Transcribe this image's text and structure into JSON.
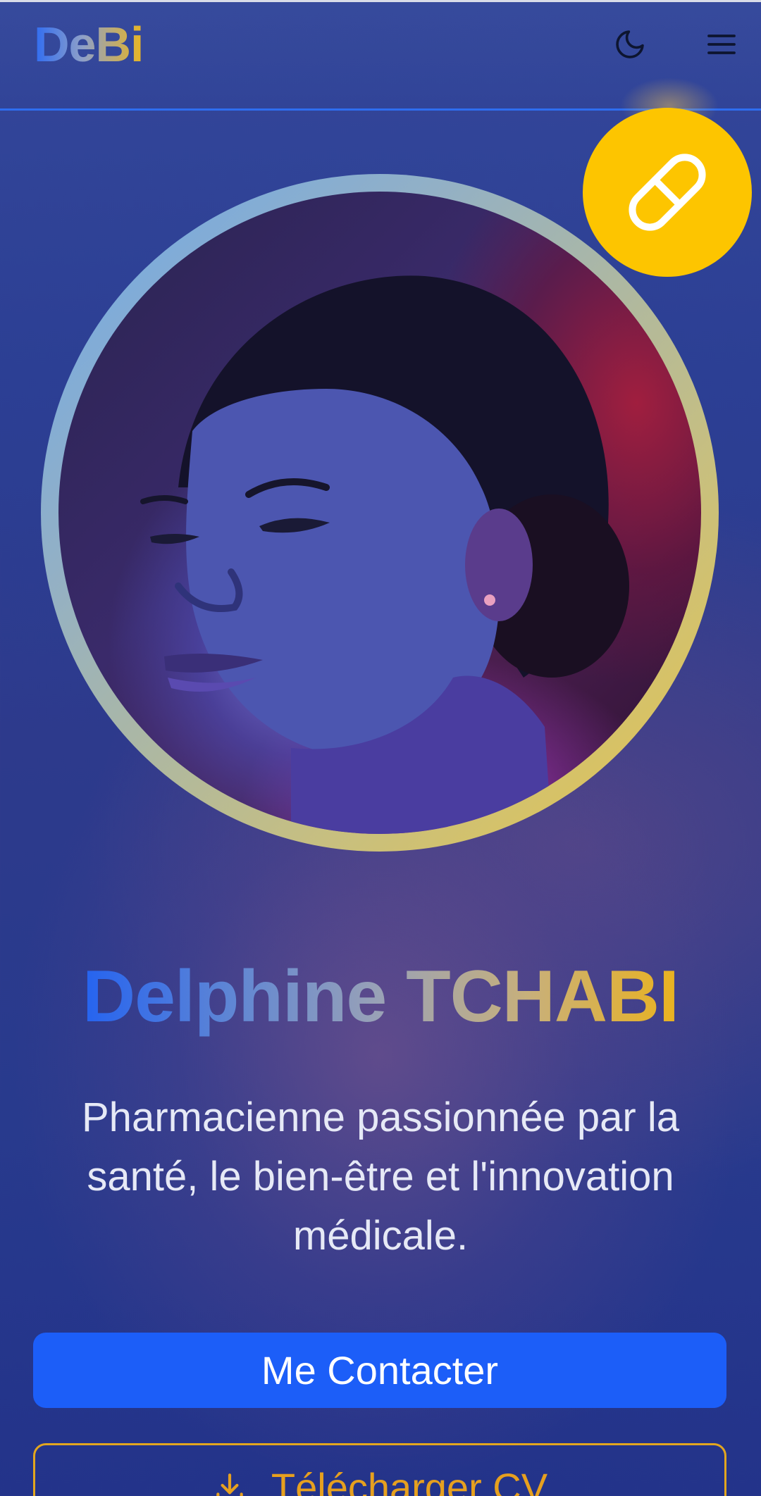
{
  "navbar": {
    "logo_text": "DeBi",
    "theme_toggle_icon": "moon-icon",
    "menu_icon": "hamburger-menu-icon"
  },
  "hero": {
    "badge_icon": "pill-icon",
    "avatar_alt": "Delphine TCHABI",
    "name": "Delphine TCHABI",
    "tagline": "Pharmacienne passionnée par la santé, le bien-être et l'innovation médicale.",
    "contact_button_label": "Me Contacter",
    "cv_button_label": "Télécharger CV",
    "cv_button_icon": "download-icon"
  },
  "colors": {
    "primary": "#1c5ef8",
    "accent": "#fdc500",
    "cv_outline": "#e2a61f",
    "nav_border": "#2e6ef0"
  }
}
